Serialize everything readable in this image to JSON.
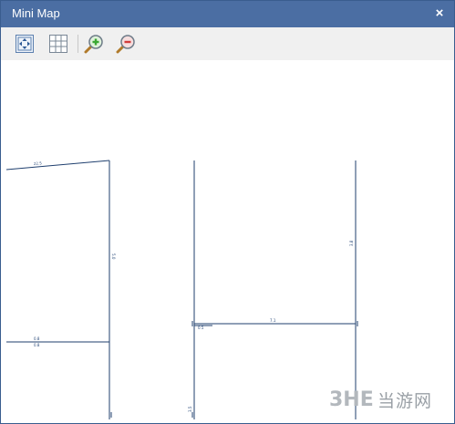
{
  "window": {
    "title": "Mini Map",
    "close_glyph": "×"
  },
  "toolbar": {
    "buttons": [
      {
        "name": "fit-view-button",
        "icon": "fit-view-icon"
      },
      {
        "name": "grid-button",
        "icon": "grid-icon"
      },
      {
        "name": "zoom-in-button",
        "icon": "zoom-in-icon"
      },
      {
        "name": "zoom-out-button",
        "icon": "zoom-out-icon"
      }
    ]
  },
  "map": {
    "line_color": "#1f3f6e",
    "dimension_labels": [
      {
        "name": "dim-top-slope",
        "text": "22.5"
      },
      {
        "name": "dim-left-vertical",
        "text": "5.0"
      },
      {
        "name": "dim-left-horizontal-1",
        "text": "0.8"
      },
      {
        "name": "dim-left-horizontal-2",
        "text": "0.8"
      },
      {
        "name": "dim-middle-horizontal",
        "text": "7.1"
      },
      {
        "name": "dim-right-vertical",
        "text": "3.8"
      },
      {
        "name": "dim-bottom-left",
        "text": "0.5"
      },
      {
        "name": "dim-bottom-middle",
        "text": "3.5"
      }
    ]
  },
  "watermark": {
    "logo_text": "3HE",
    "text": "当游网"
  },
  "colors": {
    "titlebar": "#4b6ea3",
    "toolbar": "#f0f0f0",
    "accent_green": "#3aa832",
    "accent_red": "#d23a3a"
  }
}
